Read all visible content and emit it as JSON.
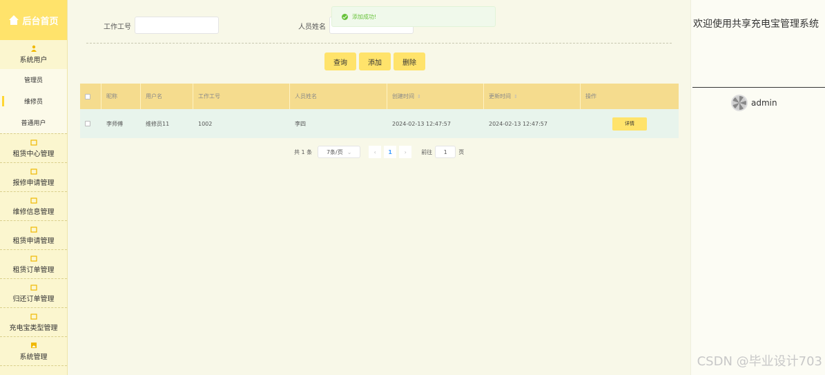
{
  "sidebar": {
    "logo": "后台首页",
    "group_system_users": "系统用户",
    "sub_items": [
      "管理员",
      "维修员",
      "普通用户"
    ],
    "groups": [
      "租赁中心管理",
      "报修申请管理",
      "维修信息管理",
      "租赁申请管理",
      "租赁订单管理",
      "归还订单管理",
      "充电宝类型管理",
      "系统管理"
    ]
  },
  "search": {
    "label_work_no": "工作工号",
    "label_name": "人员姓名",
    "work_no_value": "",
    "name_value": ""
  },
  "toast": "添加成功!",
  "buttons": {
    "query": "查询",
    "add": "添加",
    "delete": "删除"
  },
  "table": {
    "headers": [
      "昵称",
      "用户名",
      "工作工号",
      "人员姓名",
      "创建时间",
      "更新时间",
      "操作"
    ],
    "rows": [
      {
        "nickname": "李师傅",
        "username": "维修员11",
        "work_no": "1002",
        "name": "李四",
        "created": "2024-02-13 12:47:57",
        "updated": "2024-02-13 12:47:57",
        "action": "详情"
      }
    ]
  },
  "pager": {
    "total": "共 1 条",
    "size": "7条/页",
    "current": "1",
    "goto": "前往",
    "goto_value": "1",
    "page_unit": "页"
  },
  "right": {
    "welcome": "欢迎使用共享充电宝管理系统",
    "user": "admin"
  },
  "watermark": "CSDN @毕业设计703",
  "colors": {
    "accent": "#ffe36b",
    "header": "#f5dc8e",
    "sidebar": "#fbf6cf",
    "success": "#67c23a"
  }
}
